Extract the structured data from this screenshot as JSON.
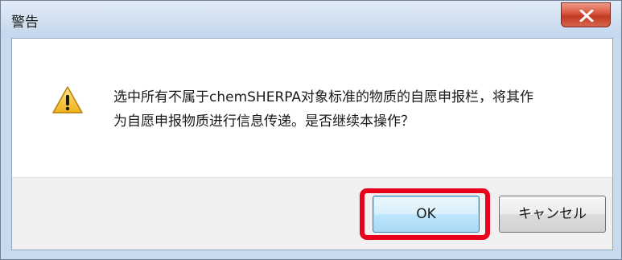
{
  "window": {
    "title": "警告"
  },
  "message": {
    "line1": "选中所有不属于chemSHERPA对象标准的物质的自愿申报栏，将其作",
    "line2": "为自愿申报物质进行信息传递。是否继续本操作？",
    "icon": "warning-icon"
  },
  "buttons": {
    "ok": "OK",
    "cancel": "キャンセル"
  },
  "colors": {
    "highlight": "#e8001c",
    "close_button": "#c13b22",
    "title_bar": "#cfdff0"
  }
}
